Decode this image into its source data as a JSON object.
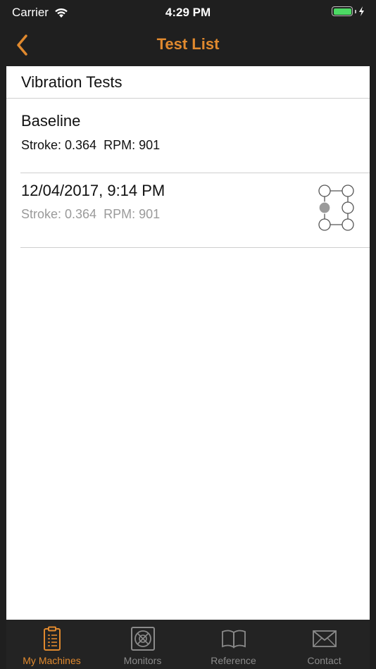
{
  "status_bar": {
    "carrier": "Carrier",
    "time": "4:29 PM",
    "battery_color": "#4cd964"
  },
  "nav": {
    "title": "Test List",
    "back_icon": "chevron-left-icon",
    "accent_color": "#e0892e"
  },
  "section": {
    "header": "Vibration Tests"
  },
  "tests": [
    {
      "name": "Baseline",
      "stroke": "Stroke: 0.364",
      "rpm": "RPM: 901"
    },
    {
      "name": "12/04/2017, 9:14 PM",
      "stroke": "Stroke: 0.364",
      "rpm": "RPM: 901",
      "icon": "measurement-position-icon"
    }
  ],
  "tabs": [
    {
      "label": "My Machines",
      "icon": "clipboard-icon",
      "active": true
    },
    {
      "label": "Monitors",
      "icon": "monitor-icon",
      "active": false
    },
    {
      "label": "Reference",
      "icon": "book-icon",
      "active": false
    },
    {
      "label": "Contact",
      "icon": "envelope-icon",
      "active": false
    }
  ]
}
